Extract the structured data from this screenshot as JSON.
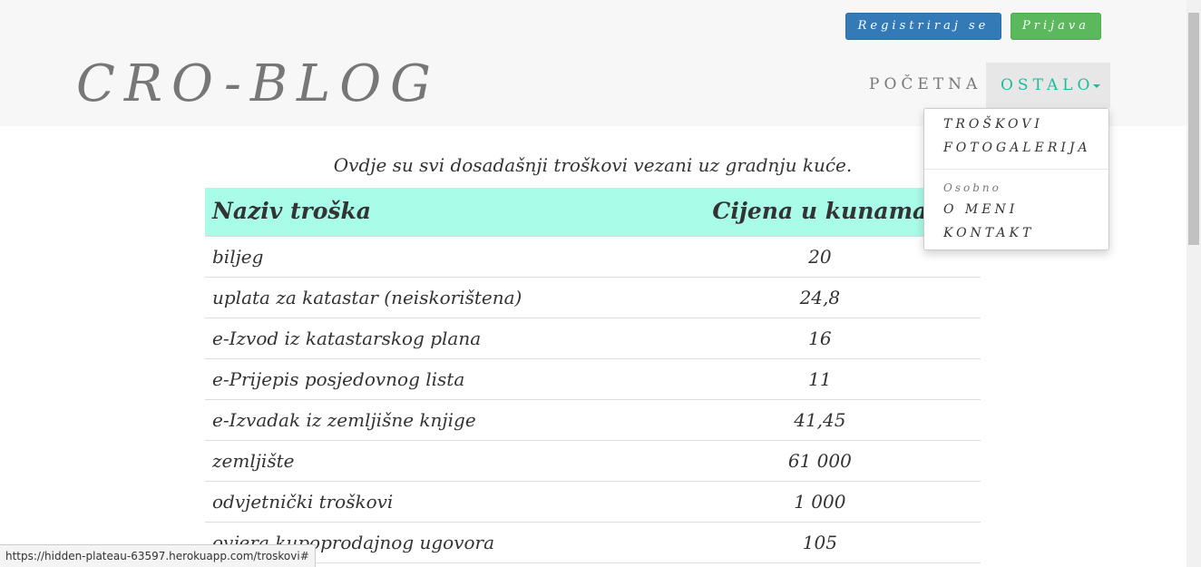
{
  "header": {
    "brand": "CRO-BLOG",
    "register_label": "Registriraj se",
    "login_label": "Prijava",
    "nav": {
      "home_label": "POČETNA",
      "other_label": "OSTALO"
    }
  },
  "dropdown": {
    "items": [
      {
        "label": "TROŠKOVI"
      },
      {
        "label": "FOTOGALERIJA"
      }
    ],
    "section_header": "Osobno",
    "personal_items": [
      {
        "label": "O MENI"
      },
      {
        "label": "KONTAKT"
      }
    ]
  },
  "main": {
    "intro": "Ovdje su svi dosadašnji troškovi vezani uz gradnju kuće.",
    "table": {
      "headers": [
        "Naziv troška",
        "Cijena u kunama"
      ],
      "rows": [
        {
          "name": "biljeg",
          "price": "20"
        },
        {
          "name": "uplata za katastar (neiskorištena)",
          "price": "24,8"
        },
        {
          "name": "e-Izvod iz katastarskog plana",
          "price": "16"
        },
        {
          "name": "e-Prijepis posjedovnog lista",
          "price": "11"
        },
        {
          "name": "e-Izvadak iz zemljišne knjige",
          "price": "41,45"
        },
        {
          "name": "zemljište",
          "price": "61 000"
        },
        {
          "name": "odvjetnički troškovi",
          "price": "1 000"
        },
        {
          "name": "ovjera kupoprodajnog ugovora",
          "price": "105"
        }
      ]
    }
  },
  "status_bar": {
    "url": "https://hidden-plateau-63597.herokuapp.com/troskovi#"
  },
  "colors": {
    "header_bg": "#f7f7f7",
    "register_button": "#337ab7",
    "login_button": "#5cb85c",
    "accent": "#1abc9c",
    "table_header_bg": "#a8fce8"
  }
}
